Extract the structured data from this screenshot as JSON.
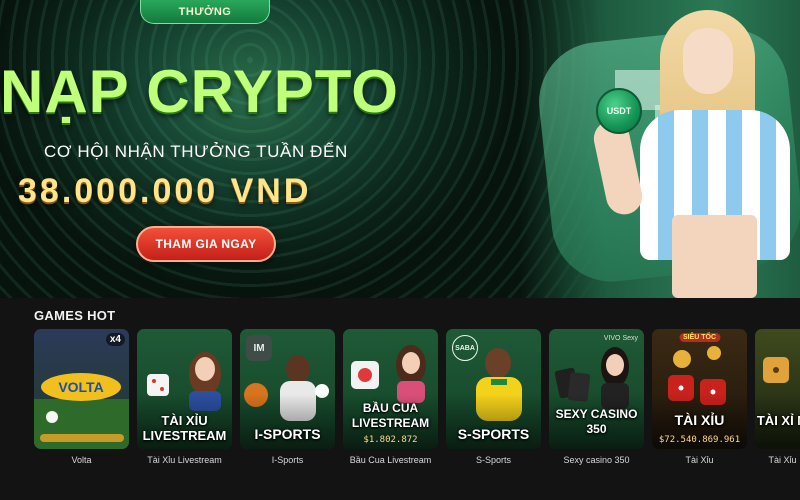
{
  "banner": {
    "reward_tab": "THƯỞNG",
    "coin_label": "USDT",
    "title": "NẠP CRYPTO",
    "subtitle": "CƠ HỘI NHẬN THƯỞNG TUẦN ĐẾN",
    "amount": "38.000.000 VND",
    "cta_label": "THAM GIA NGAY"
  },
  "games_hot": {
    "title": "GAMES HOT",
    "cards": [
      {
        "caption": "Volta",
        "art_text": "",
        "badge": "x4",
        "value": ""
      },
      {
        "caption": "Tài Xỉu Livestream",
        "art_text": "TÀI XỈU LIVESTREAM",
        "value": ""
      },
      {
        "caption": "I-Sports",
        "art_text": "I-SPORTS",
        "icon": "IM",
        "value": ""
      },
      {
        "caption": "Bầu Cua Livestream",
        "art_text": "BẦU CUA LIVESTREAM",
        "value": "$1.802.872"
      },
      {
        "caption": "S-Sports",
        "art_text": "S-SPORTS",
        "icon": "SABA",
        "value": ""
      },
      {
        "caption": "Sexy casino 350",
        "art_text": "SEXY CASINO 350",
        "provider": "VIVO Sexy",
        "value": ""
      },
      {
        "caption": "Tài Xỉu",
        "art_text": "TÀI XỈU",
        "provider": "SIÊU TỐC",
        "value": "$72.540.869.961"
      },
      {
        "caption": "Tài Xỉu",
        "art_text": "TÀI XỈ M",
        "value": ""
      }
    ]
  },
  "colors": {
    "title_green": "#bfff7a",
    "amount_gold": "#ffe48a",
    "cta_red": "#d9301f",
    "card_green": "#1f5a36",
    "page_bg": "#131313"
  }
}
